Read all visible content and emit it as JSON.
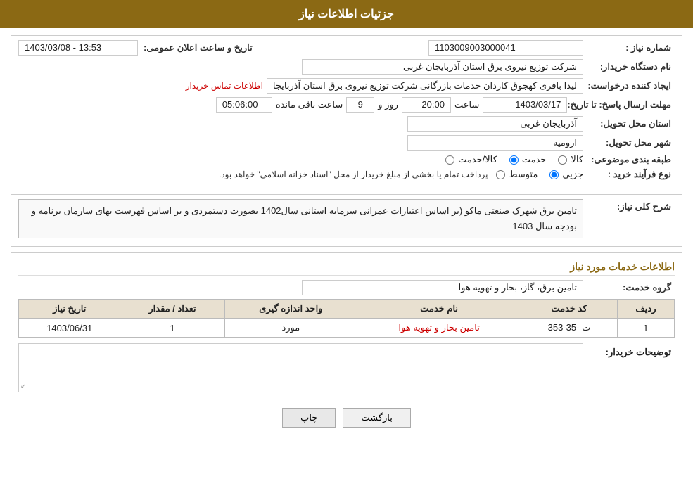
{
  "header": {
    "title": "جزئیات اطلاعات نیاز"
  },
  "fields": {
    "need_number_label": "شماره نیاز :",
    "need_number_value": "1103009003000041",
    "buyer_org_label": "نام دستگاه خریدار:",
    "buyer_org_value": "شرکت توزیع نیروی برق استان آذربایجان غربی",
    "creator_label": "ایجاد کننده درخواست:",
    "creator_value": "لیدا بافری کهجوق کاردان خدمات بازرگانی شرکت توزیع نیروی برق استان آذربایجا",
    "contact_link": "اطلاعات تماس خریدار",
    "send_date_label": "مهلت ارسال پاسخ: تا تاریخ:",
    "send_date_value": "1403/03/17",
    "send_time_label": "ساعت",
    "send_time_value": "20:00",
    "send_days_label": "روز و",
    "send_days_value": "9",
    "send_remaining_label": "ساعت باقی مانده",
    "send_remaining_value": "05:06:00",
    "public_date_label": "تاریخ و ساعت اعلان عمومی:",
    "public_date_value": "1403/03/08 - 13:53",
    "province_label": "استان محل تحویل:",
    "province_value": "آذربایجان غربی",
    "city_label": "شهر محل تحویل:",
    "city_value": "ارومیه",
    "category_label": "طبقه بندی موضوعی:",
    "category_options": [
      {
        "label": "کالا",
        "value": "kala",
        "checked": false
      },
      {
        "label": "خدمت",
        "value": "khedmat",
        "checked": true
      },
      {
        "label": "کالا/خدمت",
        "value": "kala_khedmat",
        "checked": false
      }
    ],
    "purchase_type_label": "نوع فرآیند خرید :",
    "purchase_type_options": [
      {
        "label": "جزیی",
        "value": "jozi",
        "checked": true
      },
      {
        "label": "متوسط",
        "value": "motavasset",
        "checked": false
      }
    ],
    "purchase_note": "پرداخت تمام یا بخشی از مبلغ خریدار از محل \"اسناد خزانه اسلامی\" خواهد بود.",
    "description_label": "شرح کلی نیاز:",
    "description_value": "تامین برق شهرک صنعتی ماکو (بر اساس اعتبارات عمرانی سرمایه استانی سال1402 بصورت دستمزدی  و بر اساس فهرست بهای سازمان برنامه و بودجه سال 1403",
    "service_info_title": "اطلاعات خدمات مورد نیاز",
    "service_group_label": "گروه خدمت:",
    "service_group_value": "تامین برق، گاز، بخار و تهویه هوا",
    "table": {
      "headers": [
        "ردیف",
        "کد خدمت",
        "نام خدمت",
        "واحد اندازه گیری",
        "تعداد / مقدار",
        "تاریخ نیاز"
      ],
      "rows": [
        {
          "row": "1",
          "code": "ت -35-353",
          "name": "تامین بخار و تهویه هوا",
          "unit": "مورد",
          "quantity": "1",
          "date": "1403/06/31"
        }
      ]
    },
    "buyer_notes_label": "توضیحات خریدار:",
    "buyer_notes_value": ""
  },
  "buttons": {
    "print": "چاپ",
    "back": "بازگشت"
  }
}
